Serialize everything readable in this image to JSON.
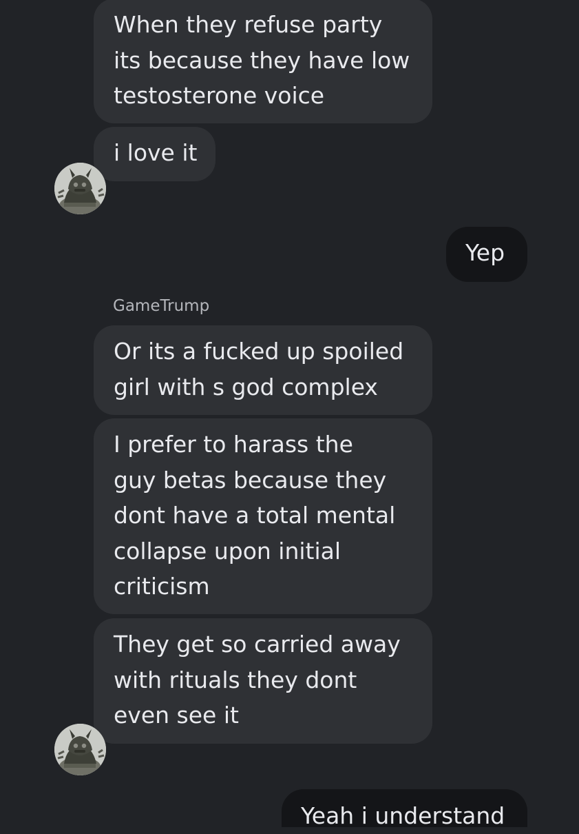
{
  "chat": {
    "messages": [
      {
        "lines": [
          "When they refuse party",
          "its because they have low",
          "testosterone voice"
        ]
      },
      {
        "lines": [
          "i love it"
        ]
      },
      {
        "lines": [
          "Yep"
        ]
      },
      {
        "lines": [
          "Or its a fucked up spoiled",
          "girl with s god complex"
        ]
      },
      {
        "lines": [
          "I prefer to harass the",
          "guy betas because they",
          "dont have a total mental",
          "collapse upon initial",
          "criticism"
        ]
      },
      {
        "lines": [
          "They get so carried away",
          "with rituals they dont",
          "even see it"
        ]
      },
      {
        "lines": [
          "Yeah i understand"
        ]
      }
    ],
    "sender_name": "GameTrump"
  },
  "colors": {
    "background": "#212327",
    "incoming_bubble": "#2f3135",
    "outgoing_bubble": "#141518",
    "text": "#e9eaee",
    "sender_name": "#b4b6bb"
  },
  "icons": {
    "avatar": "gorilla-avatar-icon"
  }
}
